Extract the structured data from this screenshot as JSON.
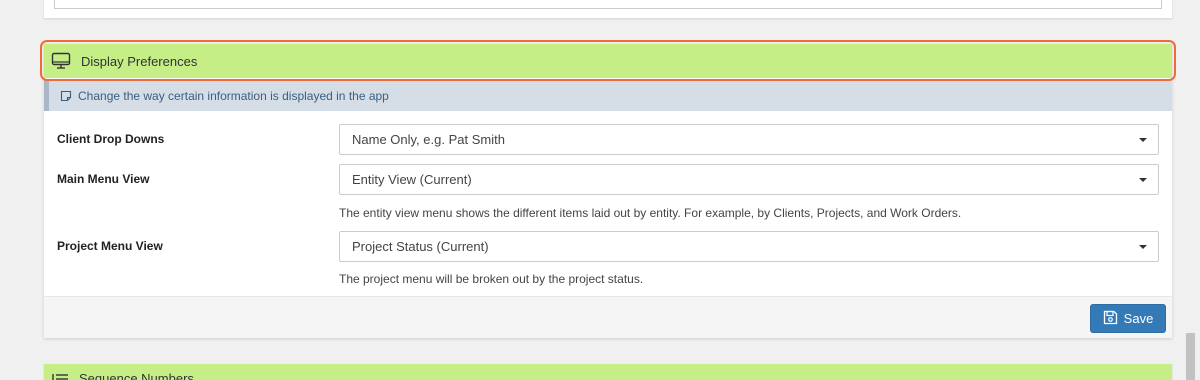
{
  "display_preferences": {
    "title": "Display Preferences",
    "info": "Change the way certain information is displayed in the app",
    "rows": [
      {
        "label": "Client Drop Downs",
        "value": "Name Only, e.g. Pat Smith",
        "help": ""
      },
      {
        "label": "Main Menu View",
        "value": "Entity View (Current)",
        "help": "The entity view menu shows the different items laid out by entity. For example, by Clients, Projects, and Work Orders."
      },
      {
        "label": "Project Menu View",
        "value": "Project Status (Current)",
        "help": "The project menu will be broken out by the project status."
      }
    ],
    "save_label": "Save"
  },
  "next_section": {
    "title": "Sequence Numbers"
  },
  "colors": {
    "header_bg": "#c5ef86",
    "highlight": "#ef6b3a",
    "button": "#337ab7"
  },
  "icons": {
    "header": "monitor-icon",
    "info": "note-icon",
    "save": "floppy-disk-icon",
    "next_section": "list-icon"
  }
}
